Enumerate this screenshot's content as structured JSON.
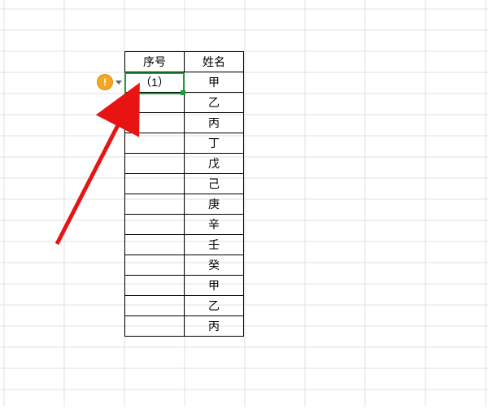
{
  "smart_tag": {
    "glyph": "!"
  },
  "headers": {
    "seq": "序号",
    "name": "姓名"
  },
  "selected": {
    "value": "（1）"
  },
  "rows": [
    {
      "seq": "（1）",
      "name": "甲"
    },
    {
      "seq": "",
      "name": "乙"
    },
    {
      "seq": "",
      "name": "丙"
    },
    {
      "seq": "",
      "name": "丁"
    },
    {
      "seq": "",
      "name": "戊"
    },
    {
      "seq": "",
      "name": "己"
    },
    {
      "seq": "",
      "name": "庚"
    },
    {
      "seq": "",
      "name": "辛"
    },
    {
      "seq": "",
      "name": "壬"
    },
    {
      "seq": "",
      "name": "癸"
    },
    {
      "seq": "",
      "name": "甲"
    },
    {
      "seq": "",
      "name": "乙"
    },
    {
      "seq": "",
      "name": "丙"
    }
  ]
}
